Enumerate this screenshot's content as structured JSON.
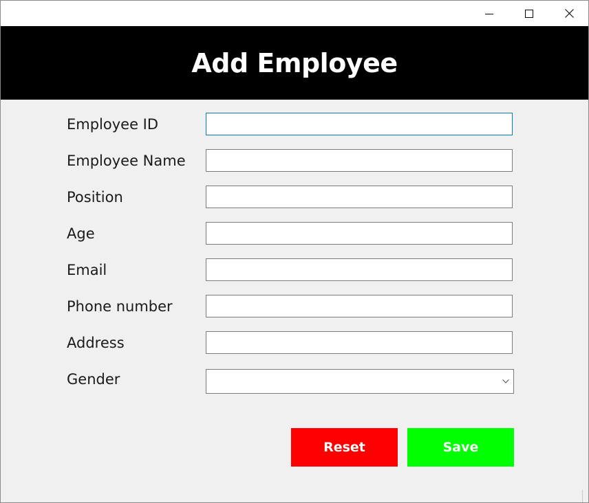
{
  "window": {
    "controls": {
      "minimize_icon": "minimize-icon",
      "maximize_icon": "maximize-icon",
      "close_icon": "close-icon"
    }
  },
  "header": {
    "title": "Add Employee",
    "background": "#000000",
    "color": "#ffffff"
  },
  "form": {
    "fields": [
      {
        "label": "Employee ID",
        "value": "",
        "type": "text"
      },
      {
        "label": "Employee Name",
        "value": "",
        "type": "text"
      },
      {
        "label": "Position",
        "value": "",
        "type": "text"
      },
      {
        "label": "Age",
        "value": "",
        "type": "text"
      },
      {
        "label": "Email",
        "value": "",
        "type": "text"
      },
      {
        "label": "Phone number",
        "value": "",
        "type": "text"
      },
      {
        "label": "Address",
        "value": "",
        "type": "text"
      }
    ],
    "gender": {
      "label": "Gender",
      "selected": ""
    }
  },
  "actions": {
    "reset_label": "Reset",
    "save_label": "Save",
    "reset_color": "#ff0000",
    "save_color": "#00ff00"
  }
}
